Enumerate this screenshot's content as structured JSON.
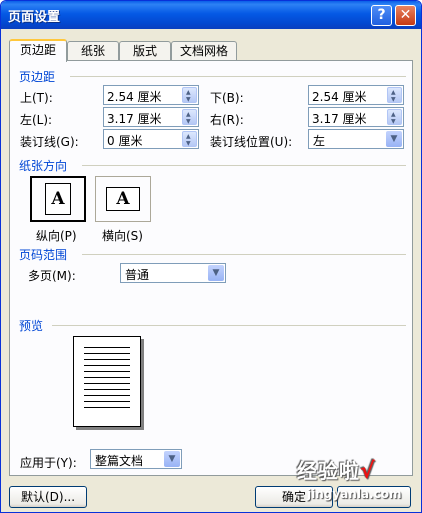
{
  "window": {
    "title": "页面设置",
    "help_label": "?",
    "close_label": "✕"
  },
  "tabs": [
    {
      "label": "页边距",
      "active": true
    },
    {
      "label": "纸张",
      "active": false
    },
    {
      "label": "版式",
      "active": false
    },
    {
      "label": "文档网格",
      "active": false
    }
  ],
  "margins": {
    "section_title": "页边距",
    "top_label": "上(T):",
    "top_value": "2.54 厘米",
    "bottom_label": "下(B):",
    "bottom_value": "2.54 厘米",
    "left_label": "左(L):",
    "left_value": "3.17 厘米",
    "right_label": "右(R):",
    "right_value": "3.17 厘米",
    "gutter_label": "装订线(G):",
    "gutter_value": "0 厘米",
    "gutter_pos_label": "装订线位置(U):",
    "gutter_pos_value": "左"
  },
  "orientation": {
    "section_title": "纸张方向",
    "glyph": "A",
    "portrait_label": "纵向(P)",
    "landscape_label": "横向(S)",
    "selected": "portrait"
  },
  "pages": {
    "section_title": "页码范围",
    "multiple_label": "多页(M):",
    "multiple_value": "普通"
  },
  "preview": {
    "section_title": "预览",
    "apply_label": "应用于(Y):",
    "apply_value": "整篇文档"
  },
  "footer": {
    "default_label": "默认(D)...",
    "ok_label": "确定"
  },
  "watermark": {
    "text": "经验啦",
    "check": "√",
    "url": "jingyanla.com"
  },
  "icons": {
    "spin_up": "▲",
    "spin_down": "▼",
    "dropdown": "▼"
  }
}
